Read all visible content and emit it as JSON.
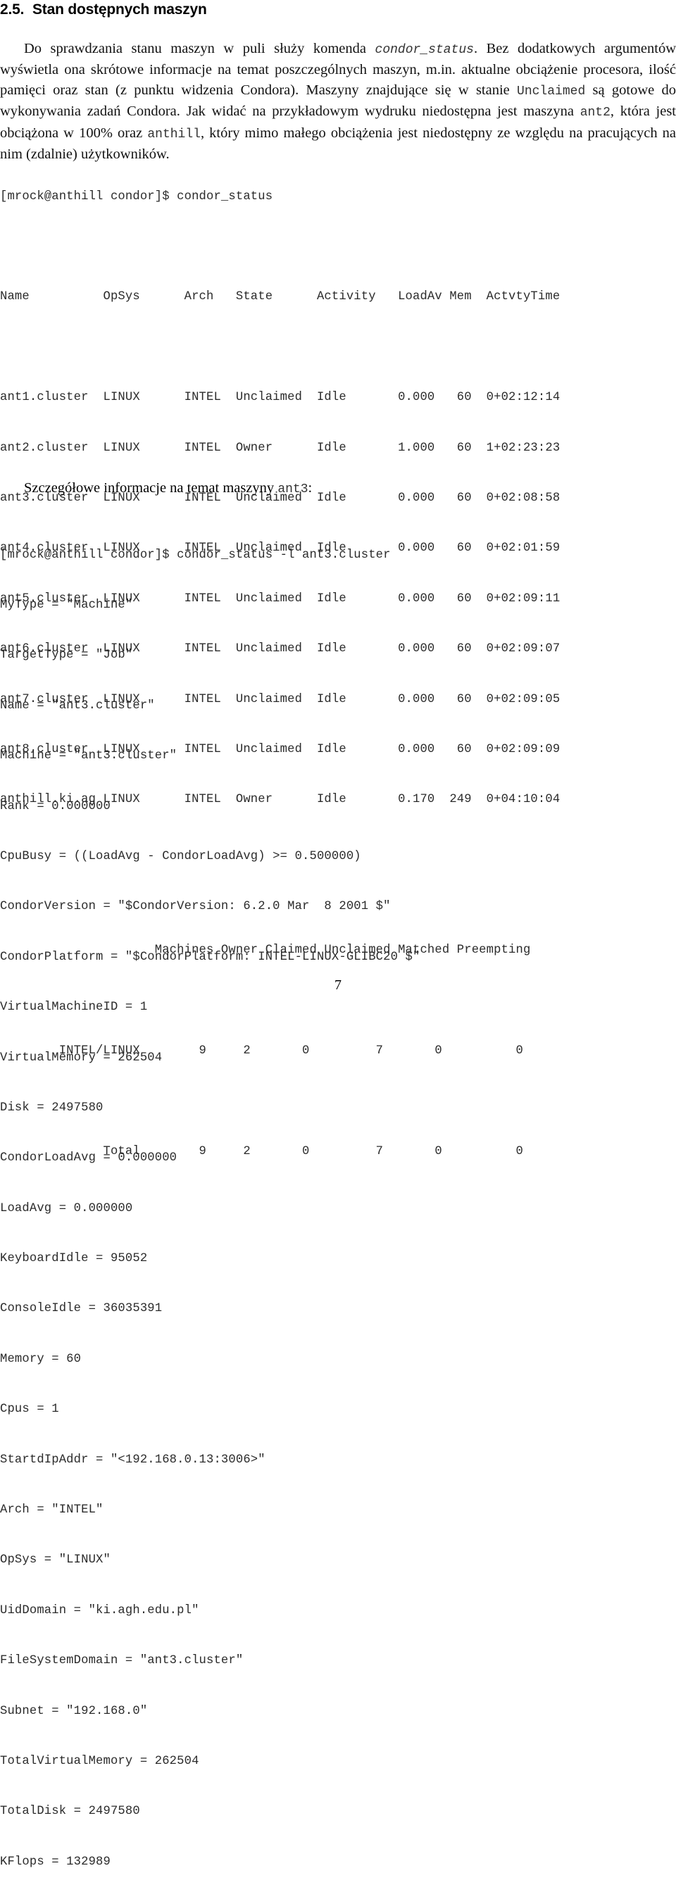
{
  "document": {
    "page_number": "7",
    "section": {
      "number": "2.5.",
      "title": "Stan dostępnych maszyn"
    },
    "paragraph": {
      "part1": "Do sprawdzania stanu maszyn w puli służy komenda ",
      "mono1": "condor_status",
      "part2": ". Bez dodatkowych argumentów wyświetla ona skrótowe informacje na temat poszczególnych maszyn, m.in. aktualne obciążenie procesora, ilość pamięci oraz stan (z punktu widzenia Condora). Maszyny znajdujące się w stanie ",
      "mono2": "Unclaimed",
      "part3": " są gotowe do wykonywania zadań Condora. Jak widać na przykładowym wydruku niedostępna jest maszyna ",
      "mono3": "ant2",
      "part4": ", która jest obciążona w 100% oraz ",
      "mono4": "anthill",
      "part5": ", który mimo małego obciążenia jest niedostępny ze względu na pracujących na nim (zdalnie) użytkowników."
    },
    "sub_caption": {
      "text": "Szczegółowe informacje na temat maszyny ",
      "mono": "ant3",
      "suffix": ":"
    }
  },
  "terminal_status": {
    "prompt": "[mrock@anthill condor]$ condor_status",
    "table_header": "Name          OpSys      Arch   State      Activity   LoadAv Mem  ActvtyTime",
    "rows": [
      "ant1.cluster  LINUX      INTEL  Unclaimed  Idle       0.000   60  0+02:12:14",
      "ant2.cluster  LINUX      INTEL  Owner      Idle       1.000   60  1+02:23:23",
      "ant3.cluster  LINUX      INTEL  Unclaimed  Idle       0.000   60  0+02:08:58",
      "ant4.cluster  LINUX      INTEL  Unclaimed  Idle       0.000   60  0+02:01:59",
      "ant5.cluster  LINUX      INTEL  Unclaimed  Idle       0.000   60  0+02:09:11",
      "ant6.cluster  LINUX      INTEL  Unclaimed  Idle       0.000   60  0+02:09:07",
      "ant7.cluster  LINUX      INTEL  Unclaimed  Idle       0.000   60  0+02:09:05",
      "ant8.cluster  LINUX      INTEL  Unclaimed  Idle       0.000   60  0+02:09:09",
      "anthill.ki.ag LINUX      INTEL  Owner      Idle       0.170  249  0+04:10:04"
    ],
    "summary_header": "                     Machines Owner Claimed Unclaimed Matched Preempting",
    "summary_rows": [
      "        INTEL/LINUX        9     2       0         7       0          0",
      "              Total        9     2       0         7       0          0"
    ]
  },
  "terminal_long": {
    "prompt": "[mrock@anthill condor]$ condor_status -l ant3.cluster",
    "classad": [
      "MyType = \"Machine\"",
      "TargetType = \"Job\"",
      "Name = \"ant3.cluster\"",
      "Machine = \"ant3.cluster\"",
      "Rank = 0.000000",
      "CpuBusy = ((LoadAvg - CondorLoadAvg) >= 0.500000)",
      "CondorVersion = \"$CondorVersion: 6.2.0 Mar  8 2001 $\"",
      "CondorPlatform = \"$CondorPlatform: INTEL-LINUX-GLIBC20 $\"",
      "VirtualMachineID = 1",
      "VirtualMemory = 262504",
      "Disk = 2497580",
      "CondorLoadAvg = 0.000000",
      "LoadAvg = 0.000000",
      "KeyboardIdle = 95052",
      "ConsoleIdle = 36035391",
      "Memory = 60",
      "Cpus = 1",
      "StartdIpAddr = \"<192.168.0.13:3006>\"",
      "Arch = \"INTEL\"",
      "OpSys = \"LINUX\"",
      "UidDomain = \"ki.agh.edu.pl\"",
      "FileSystemDomain = \"ant3.cluster\"",
      "Subnet = \"192.168.0\"",
      "TotalVirtualMemory = 262504",
      "TotalDisk = 2497580",
      "KFlops = 132989"
    ]
  },
  "colors": {
    "text": "#000000",
    "mono_text": "#2b2b2b",
    "background": "#ffffff"
  }
}
